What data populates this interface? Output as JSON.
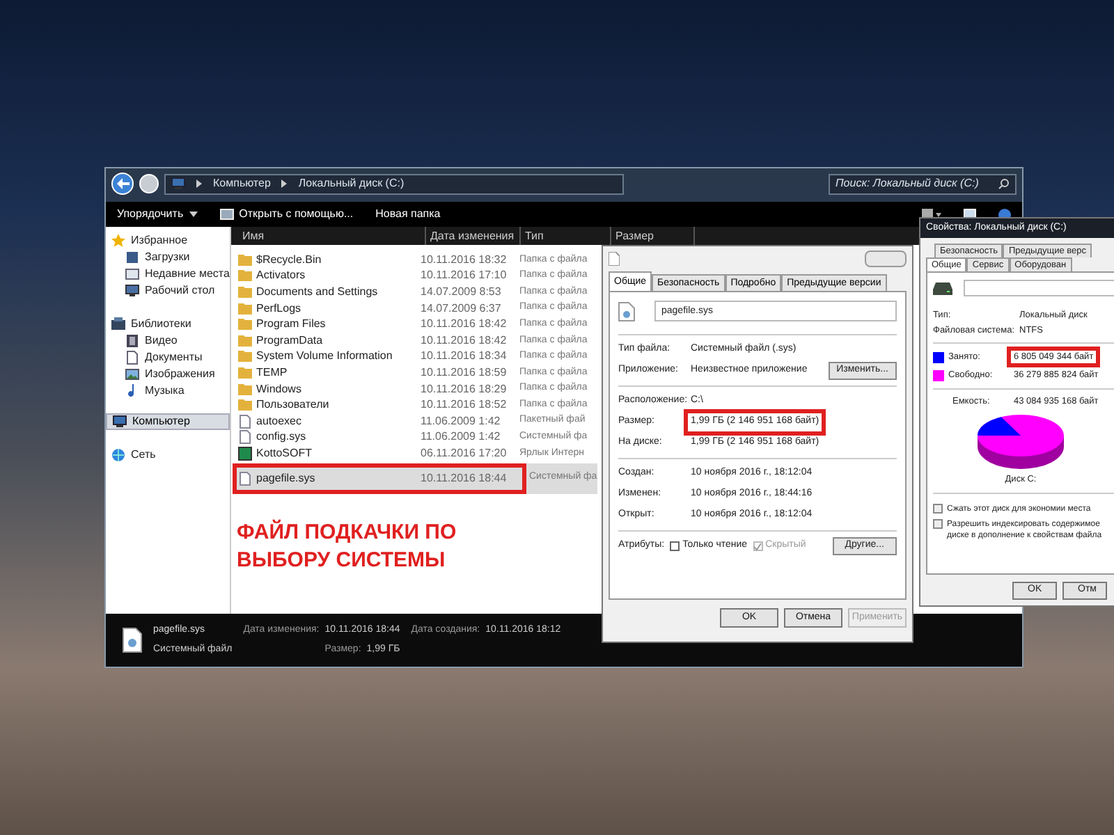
{
  "explorer": {
    "address": {
      "segments": [
        "Компьютер",
        "Локальный диск (C:)"
      ],
      "search_placeholder": "Поиск: Локальный диск (C:)"
    },
    "toolbar": {
      "items": [
        "Упорядочить",
        "Открыть с помощью...",
        "Новая папка"
      ]
    },
    "sidebar": {
      "groups": [
        {
          "label": "Избранное",
          "selected": false,
          "children": [
            {
              "label": "Загрузки",
              "selected": false
            },
            {
              "label": "Недавние места",
              "selected": false
            },
            {
              "label": "Рабочий стол",
              "selected": false
            }
          ]
        },
        {
          "label": "Библиотеки",
          "selected": false,
          "children": [
            {
              "label": "Видео",
              "selected": false
            },
            {
              "label": "Документы",
              "selected": false
            },
            {
              "label": "Изображения",
              "selected": false
            },
            {
              "label": "Музыка",
              "selected": false
            }
          ]
        },
        {
          "label": "Компьютер",
          "selected": true
        },
        {
          "label": "Сеть",
          "selected": false
        }
      ]
    },
    "table": {
      "columns": [
        "Имя",
        "Дата изменения",
        "Тип",
        "Размер"
      ],
      "rows": [
        {
          "kind": "folder",
          "name": "$Recycle.Bin",
          "date": "10.11.2016 18:32",
          "type": "Папка с файла",
          "selected": false,
          "highlighted": false
        },
        {
          "kind": "folder",
          "name": "Activators",
          "date": "10.11.2016 17:10",
          "type": "Папка с файла",
          "selected": false,
          "highlighted": false
        },
        {
          "kind": "folder",
          "name": "Documents and Settings",
          "date": "14.07.2009 8:53",
          "type": "Папка с файла",
          "selected": false,
          "highlighted": false
        },
        {
          "kind": "folder",
          "name": "PerfLogs",
          "date": "14.07.2009 6:37",
          "type": "Папка с файла",
          "selected": false,
          "highlighted": false
        },
        {
          "kind": "folder",
          "name": "Program Files",
          "date": "10.11.2016 18:42",
          "type": "Папка с файла",
          "selected": false,
          "highlighted": false
        },
        {
          "kind": "folder",
          "name": "ProgramData",
          "date": "10.11.2016 18:42",
          "type": "Папка с файла",
          "selected": false,
          "highlighted": false
        },
        {
          "kind": "folder",
          "name": "System Volume Information",
          "date": "10.11.2016 18:34",
          "type": "Папка с файла",
          "selected": false,
          "highlighted": false
        },
        {
          "kind": "folder",
          "name": "TEMP",
          "date": "10.11.2016 18:59",
          "type": "Папка с файла",
          "selected": false,
          "highlighted": false
        },
        {
          "kind": "folder",
          "name": "Windows",
          "date": "10.11.2016 18:29",
          "type": "Папка с файла",
          "selected": false,
          "highlighted": false
        },
        {
          "kind": "folder",
          "name": "Пользователи",
          "date": "10.11.2016 18:52",
          "type": "Папка с файла",
          "selected": false,
          "highlighted": false
        },
        {
          "kind": "file",
          "name": "autoexec",
          "date": "11.06.2009 1:42",
          "type": "Пакетный фай",
          "selected": false,
          "highlighted": false
        },
        {
          "kind": "file",
          "name": "config.sys",
          "date": "11.06.2009 1:42",
          "type": "Системный фа",
          "selected": false,
          "highlighted": false
        },
        {
          "kind": "shortcut",
          "name": "KottoSOFT",
          "date": "06.11.2016 17:20",
          "type": "Ярлык Интерн",
          "selected": false,
          "highlighted": false
        },
        {
          "kind": "file",
          "name": "pagefile.sys",
          "date": "10.11.2016 18:44",
          "type": "Системный фа",
          "selected": true,
          "highlighted": true
        }
      ]
    },
    "annotation": [
      "ФАЙЛ ПОДКАЧКИ ПО",
      "ВЫБОРУ СИСТЕМЫ"
    ],
    "status_bar": {
      "name": "pagefile.sys",
      "type": "Системный файл",
      "fields": [
        {
          "label": "Дата изменения:",
          "value": "10.11.2016 18:44"
        },
        {
          "label": "Дата создания:",
          "value": "10.11.2016 18:12"
        },
        {
          "label": "Размер:",
          "value": "1,99 ГБ"
        }
      ]
    }
  },
  "file_properties": {
    "tabs": [
      {
        "label": "Общие",
        "selected": true
      },
      {
        "label": "Безопасность",
        "selected": false
      },
      {
        "label": "Подробно",
        "selected": false
      },
      {
        "label": "Предыдущие версии",
        "selected": false
      }
    ],
    "filename": "pagefile.sys",
    "sections": [
      [
        {
          "label": "Тип файла:",
          "value": "Системный файл (.sys)",
          "highlighted": false
        },
        {
          "label": "Приложение:",
          "value": "Неизвестное приложение",
          "button": "Изменить...",
          "highlighted": false
        }
      ],
      [
        {
          "label": "Расположение:",
          "value": "C:\\",
          "highlighted": false
        },
        {
          "label": "Размер:",
          "value": "1,99 ГБ (2 146 951 168 байт)",
          "highlighted": true
        },
        {
          "label": "На диске:",
          "value": "1,99 ГБ (2 146 951 168 байт)",
          "highlighted": false
        }
      ],
      [
        {
          "label": "Создан:",
          "value": "10 ноября 2016 г., 18:12:04",
          "highlighted": false
        },
        {
          "label": "Изменен:",
          "value": "10 ноября 2016 г., 18:44:16",
          "highlighted": false
        },
        {
          "label": "Открыт:",
          "value": "10 ноября 2016 г., 18:12:04",
          "highlighted": false
        }
      ]
    ],
    "attributes": {
      "label": "Атрибуты:",
      "checks": [
        {
          "label": "Только чтение",
          "checked": false,
          "disabled": false
        },
        {
          "label": "Скрытый",
          "checked": true,
          "disabled": true
        }
      ],
      "button": "Другие..."
    },
    "buttons": [
      {
        "label": "OK",
        "disabled": false
      },
      {
        "label": "Отмена",
        "disabled": false
      },
      {
        "label": "Применить",
        "disabled": true
      }
    ]
  },
  "disk_properties": {
    "title": "Свойства: Локальный диск (C:)",
    "tabs_back": [
      {
        "label": "Безопасность",
        "selected": false
      },
      {
        "label": "Предыдущие верс",
        "selected": false
      }
    ],
    "tabs_front": [
      {
        "label": "Общие",
        "selected": true
      },
      {
        "label": "Сервис",
        "selected": false
      },
      {
        "label": "Оборудован",
        "selected": false
      }
    ],
    "info": [
      {
        "label": "Тип:",
        "value": "Локальный диск"
      },
      {
        "label": "Файловая система:",
        "value": "NTFS"
      }
    ],
    "usage": [
      {
        "label": "Занято:",
        "value": "6 805 049 344 байт",
        "color": "#0000ff",
        "highlighted": true
      },
      {
        "label": "Свободно:",
        "value": "36 279 885 824 байт",
        "color": "#ff00ff",
        "highlighted": false
      }
    ],
    "capacity": {
      "label": "Емкость:",
      "value": "43 084 935 168 байт"
    },
    "disk_label": "Диск C:",
    "checks": [
      {
        "lines": [
          "Сжать этот диск для экономии места"
        ],
        "checked": false
      },
      {
        "lines": [
          "Разрешить индексировать содержимое",
          "диске в дополнение к свойствам файла"
        ],
        "checked": false
      }
    ],
    "buttons": [
      "OK",
      "Отм"
    ]
  }
}
